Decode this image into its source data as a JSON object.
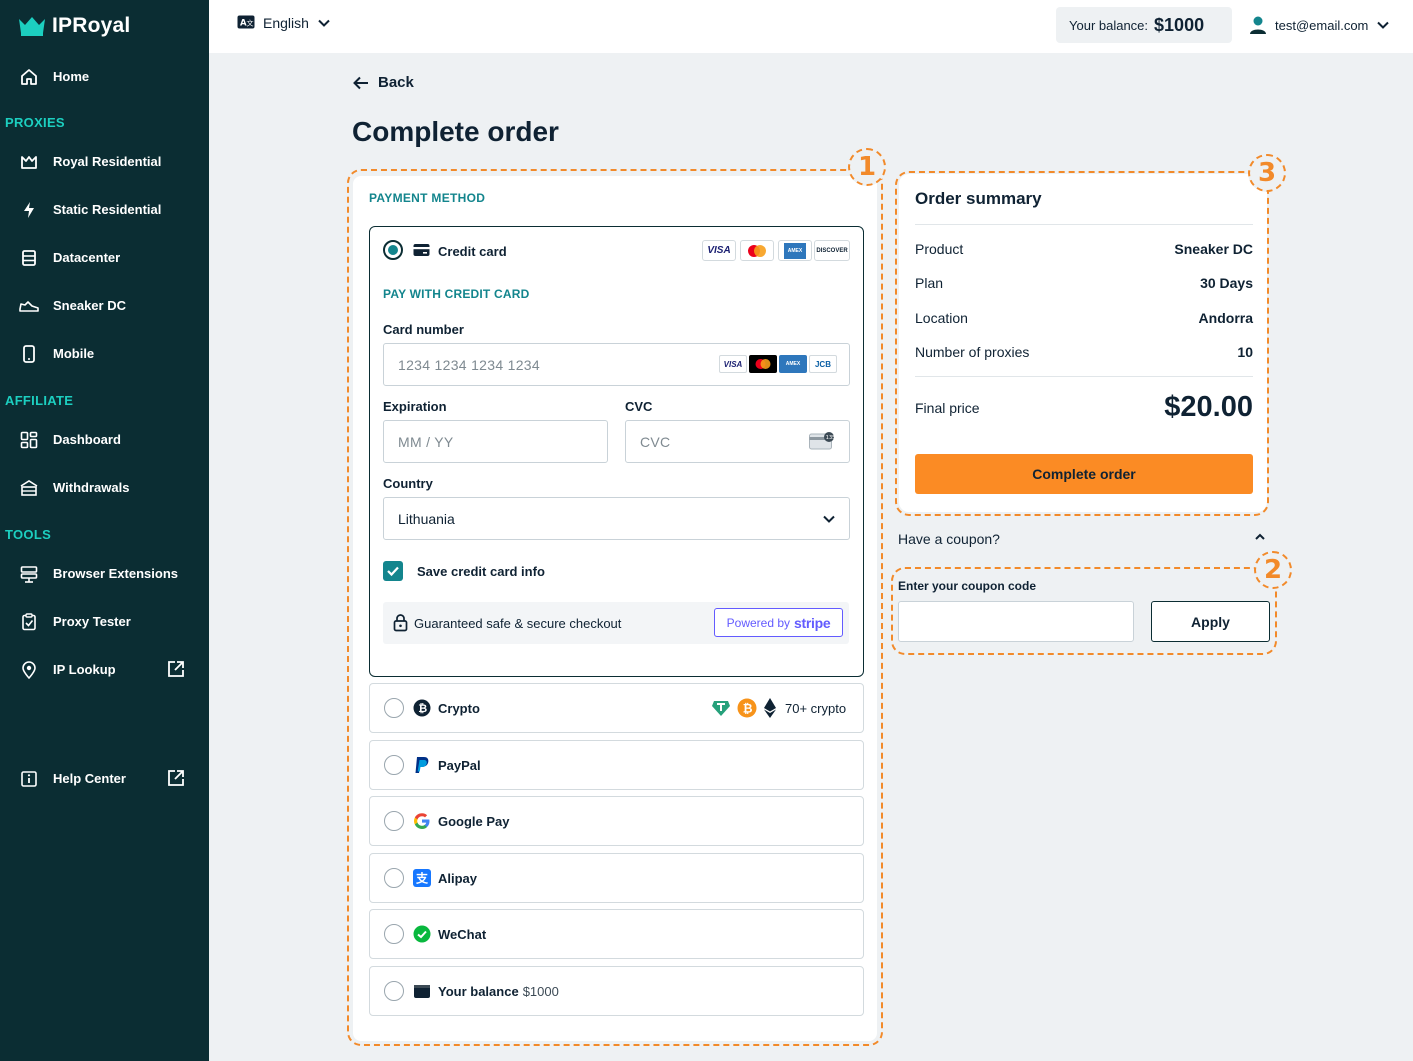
{
  "app": {
    "logo_text": "IPRoyal"
  },
  "sidebar": {
    "home": "Home",
    "section_proxies": "PROXIES",
    "proxies": [
      "Royal Residential",
      "Static Residential",
      "Datacenter",
      "Sneaker DC",
      "Mobile"
    ],
    "section_affiliate": "AFFILIATE",
    "affiliate": [
      "Dashboard",
      "Withdrawals"
    ],
    "section_tools": "TOOLS",
    "tools": [
      "Browser Extensions",
      "Proxy Tester",
      "IP Lookup"
    ],
    "help": "Help Center"
  },
  "header": {
    "language": "English",
    "balance_label": "Your balance:",
    "balance_value": "$1000",
    "user_email": "test@email.com"
  },
  "main": {
    "back_label": "Back",
    "title": "Complete order"
  },
  "annotations": {
    "one": "1",
    "two": "2",
    "three": "3"
  },
  "payment": {
    "section_label": "PAYMENT METHOD",
    "credit_card": {
      "label": "Credit card",
      "sub_label": "PAY WITH CREDIT CARD",
      "card_number_label": "Card number",
      "card_number_placeholder": "1234 1234 1234 1234",
      "expiration_label": "Expiration",
      "expiration_placeholder": "MM / YY",
      "cvc_label": "CVC",
      "cvc_placeholder": "CVC",
      "country_label": "Country",
      "country_value": "Lithuania",
      "save_label": "Save credit card info",
      "secure_text": "Guaranteed safe & secure checkout",
      "powered_by": "Powered by",
      "stripe": "stripe",
      "brands": {
        "visa": "VISA",
        "discover": "DISCOVER",
        "jcb": "JCB",
        "amex": "AMEX"
      }
    },
    "methods": {
      "crypto": "Crypto",
      "crypto_extra": "70+ crypto",
      "paypal": "PayPal",
      "google_pay": "Google Pay",
      "alipay": "Alipay",
      "wechat": "WeChat",
      "balance": "Your balance",
      "balance_extra": "$1000"
    }
  },
  "summary": {
    "title": "Order summary",
    "rows": [
      {
        "key": "Product",
        "value": "Sneaker DC"
      },
      {
        "key": "Plan",
        "value": "30 Days"
      },
      {
        "key": "Location",
        "value": "Andorra"
      },
      {
        "key": "Number of proxies",
        "value": "10"
      }
    ],
    "final_label": "Final price",
    "final_value": "$20.00",
    "complete_button": "Complete order"
  },
  "coupon": {
    "toggle": "Have a coupon?",
    "label": "Enter your coupon code",
    "input_value": "",
    "apply_button": "Apply"
  },
  "colors": {
    "sidebar": "#0b2d33",
    "accent_teal": "#13858d",
    "section_teal": "#1ccfc0",
    "orange": "#fb8b24",
    "annotation": "#f28a2a",
    "stripe": "#635bff"
  }
}
